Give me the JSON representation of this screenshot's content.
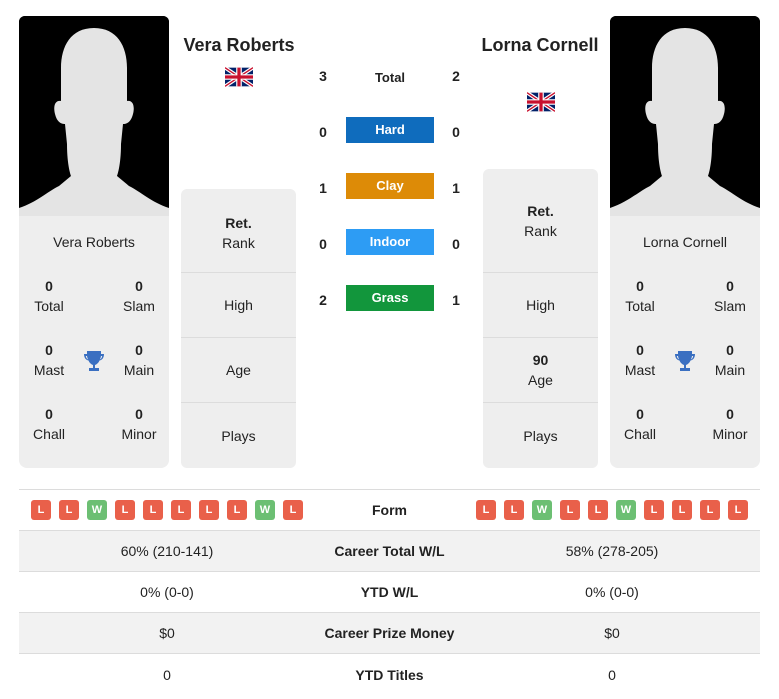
{
  "colors": {
    "hard": "#0f6cbd",
    "clay": "#dd8b07",
    "indoor": "#2d9cf4",
    "grass": "#12963c",
    "loss": "#e9604a",
    "win": "#6cbf73",
    "trophy": "#3a6fc1"
  },
  "player1": {
    "name": "Vera Roberts",
    "flag_icon": "uk-flag-icon",
    "card_name": "Vera Roberts",
    "titles": {
      "total": {
        "value": "0",
        "label": "Total"
      },
      "slam": {
        "value": "0",
        "label": "Slam"
      },
      "mast": {
        "value": "0",
        "label": "Mast"
      },
      "main": {
        "value": "0",
        "label": "Main"
      },
      "chall": {
        "value": "0",
        "label": "Chall"
      },
      "minor": {
        "value": "0",
        "label": "Minor"
      }
    },
    "info": {
      "rank": {
        "value": "Ret.",
        "label": "Rank"
      },
      "high": {
        "value": "",
        "label": "High"
      },
      "age": {
        "value": "",
        "label": "Age"
      },
      "plays": {
        "value": "",
        "label": "Plays"
      }
    },
    "form": [
      "L",
      "L",
      "W",
      "L",
      "L",
      "L",
      "L",
      "L",
      "W",
      "L"
    ],
    "career_total_wl": "60% (210-141)",
    "ytd_wl": "0% (0-0)",
    "career_prize_money": "$0",
    "ytd_titles": "0"
  },
  "player2": {
    "name": "Lorna Cornell",
    "flag_icon": "uk-flag-icon",
    "card_name": "Lorna Cornell",
    "titles": {
      "total": {
        "value": "0",
        "label": "Total"
      },
      "slam": {
        "value": "0",
        "label": "Slam"
      },
      "mast": {
        "value": "0",
        "label": "Mast"
      },
      "main": {
        "value": "0",
        "label": "Main"
      },
      "chall": {
        "value": "0",
        "label": "Chall"
      },
      "minor": {
        "value": "0",
        "label": "Minor"
      }
    },
    "info": {
      "rank": {
        "value": "Ret.",
        "label": "Rank"
      },
      "high": {
        "value": "",
        "label": "High"
      },
      "age": {
        "value": "90",
        "label": "Age"
      },
      "plays": {
        "value": "",
        "label": "Plays"
      }
    },
    "form": [
      "L",
      "L",
      "W",
      "L",
      "L",
      "W",
      "L",
      "L",
      "L",
      "L"
    ],
    "career_total_wl": "58% (278-205)",
    "ytd_wl": "0% (0-0)",
    "career_prize_money": "$0",
    "ytd_titles": "0"
  },
  "h2h": {
    "total": {
      "label": "Total",
      "p1": "3",
      "p2": "2"
    },
    "hard": {
      "label": "Hard",
      "p1": "0",
      "p2": "0"
    },
    "clay": {
      "label": "Clay",
      "p1": "1",
      "p2": "1"
    },
    "indoor": {
      "label": "Indoor",
      "p1": "0",
      "p2": "0"
    },
    "grass": {
      "label": "Grass",
      "p1": "2",
      "p2": "1"
    }
  },
  "stats_labels": {
    "form": "Form",
    "career_total_wl": "Career Total W/L",
    "ytd_wl": "YTD W/L",
    "career_prize_money": "Career Prize Money",
    "ytd_titles": "YTD Titles"
  }
}
